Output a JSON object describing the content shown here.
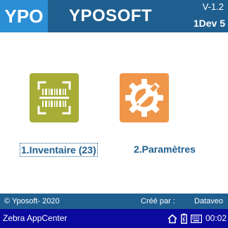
{
  "header": {
    "logo_text": "YPO",
    "title": "YPOSOFT",
    "version": "V-1.2",
    "device": "1Dev 5"
  },
  "menu": {
    "items": [
      {
        "label": "1.Inventaire (23)",
        "icon": "barcode-scan-icon",
        "color": "#a7ad37"
      },
      {
        "label": "2.Paramètres",
        "icon": "settings-wrench-icon",
        "color": "#f0964a"
      }
    ]
  },
  "footer": {
    "copyright": "© Yposoft- 2020",
    "created_by_label": "Créé par :",
    "created_by_value": "Dataveo"
  },
  "statusbar": {
    "app_name": "Zebra AppCenter",
    "time": "00:02"
  }
}
